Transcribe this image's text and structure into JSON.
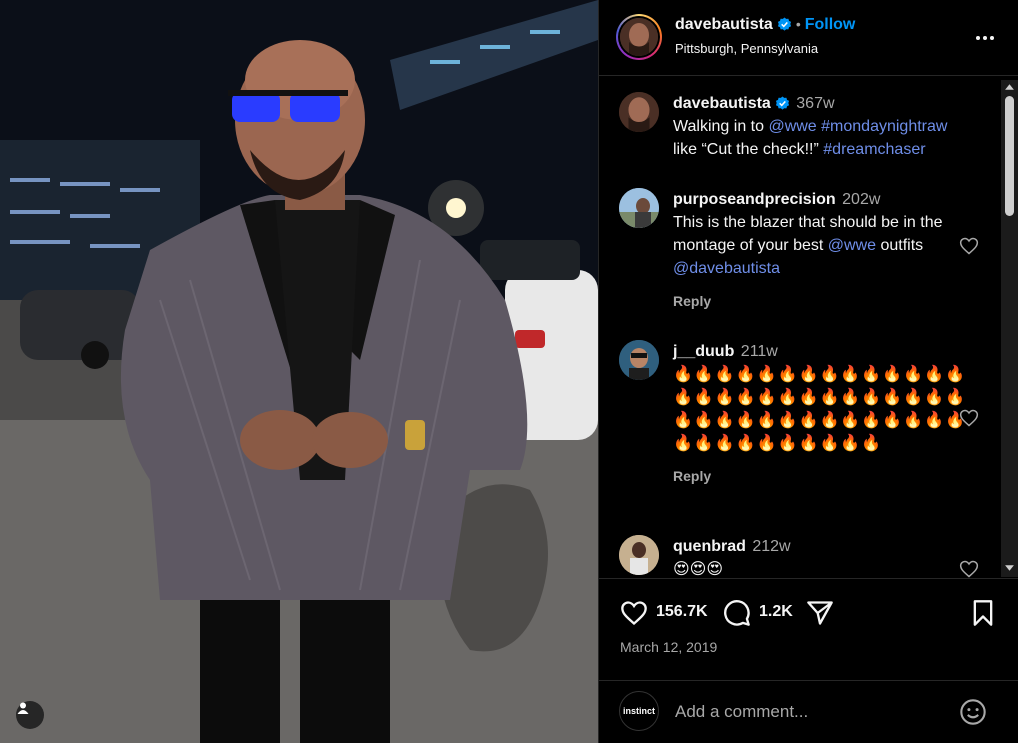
{
  "post": {
    "username": "davebautista",
    "follow_label": "Follow",
    "separator": "•",
    "location": "Pittsburgh, Pennsylvania",
    "likes": "156.7K",
    "comments_count": "1.2K",
    "date": "March 12, 2019"
  },
  "caption": {
    "username": "davebautista",
    "time": "367w",
    "text_prefix": "Walking in to ",
    "mention": "@wwe",
    "hashtag1": "#mondaynightraw",
    "text_middle": "like “Cut the check!!” ",
    "hashtag2": "#dreamchaser"
  },
  "comments": [
    {
      "username": "purposeandprecision",
      "time": "202w",
      "text_prefix": "This is the blazer that should be in the montage of your best ",
      "mention1": "@wwe",
      "text_middle": " outfits ",
      "mention2": "@davebautista",
      "reply_label": "Reply"
    },
    {
      "username": "j__duub",
      "time": "211w",
      "text": "🔥🔥🔥🔥🔥🔥🔥🔥🔥🔥🔥🔥🔥🔥🔥🔥🔥🔥🔥🔥🔥🔥🔥🔥🔥🔥🔥🔥🔥🔥🔥🔥🔥🔥🔥🔥🔥🔥🔥🔥🔥🔥🔥🔥🔥🔥🔥🔥🔥🔥🔥🔥",
      "reply_label": "Reply"
    },
    {
      "username": "quenbrad",
      "time": "212w",
      "text": "😍😍😍"
    }
  ],
  "add_comment": {
    "placeholder": "Add a comment...",
    "avatar_text": "instinct"
  },
  "colors": {
    "link": "#6f8ee8",
    "follow": "#0095f6",
    "verified": "#0095f6"
  }
}
